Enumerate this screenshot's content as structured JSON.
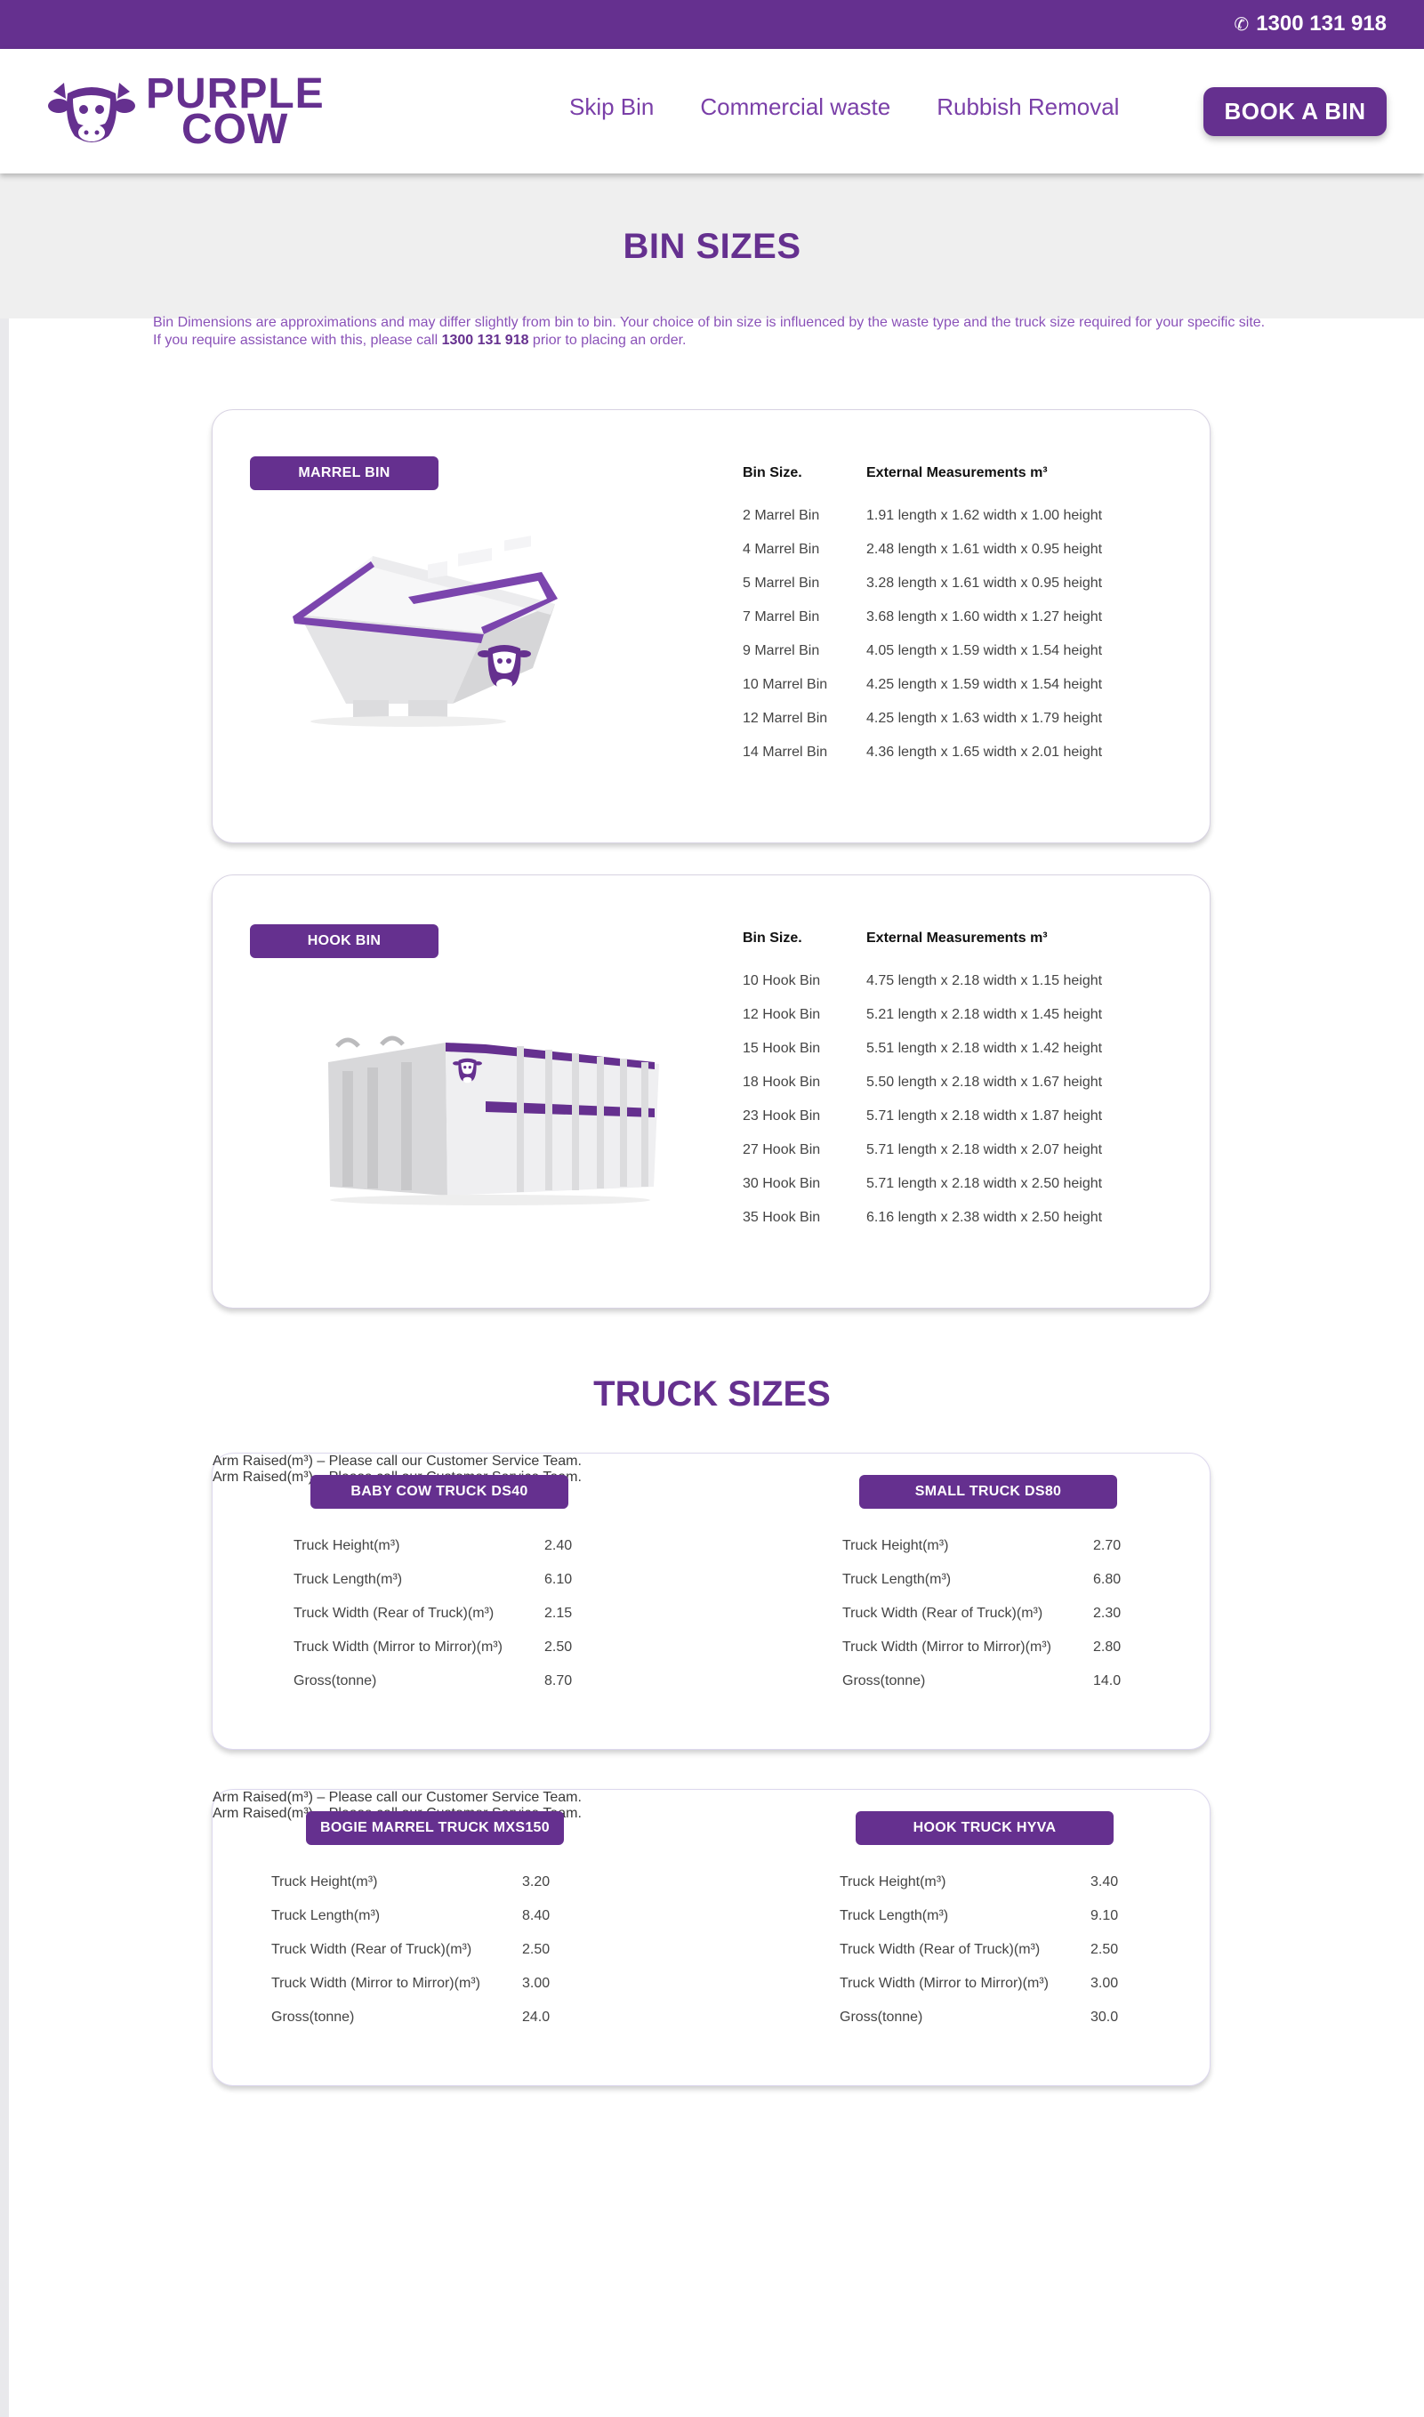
{
  "topbar": {
    "phone": "1300 131 918",
    "phone_icon": "phone-icon"
  },
  "logo": {
    "line1": "PURPLE",
    "line2": "COW",
    "icon": "cow-head-icon"
  },
  "nav": {
    "items": [
      "Skip Bin",
      "Commercial waste",
      "Rubbish Removal"
    ]
  },
  "book_button": "BOOK A BIN",
  "hero": {
    "title": "BIN SIZES"
  },
  "intro": {
    "text1": "Bin Dimensions are approximations and may differ slightly from bin to bin. Your choice of bin size is influenced by the waste type and the truck size required for your specific site. If you require assistance with this, please call ",
    "phone": "1300 131 918",
    "text2": " prior to placing an order."
  },
  "bins": [
    {
      "label": "MARREL BIN",
      "header": [
        "Bin Size.",
        "External Measurements m³"
      ],
      "rows": [
        [
          "2 Marrel Bin",
          "1.91 length x 1.62 width x 1.00 height"
        ],
        [
          "4 Marrel Bin",
          "2.48 length x 1.61 width x 0.95 height"
        ],
        [
          "5 Marrel Bin",
          "3.28 length x 1.61 width x 0.95 height"
        ],
        [
          "7 Marrel Bin",
          "3.68 length x 1.60 width x 1.27 height"
        ],
        [
          "9 Marrel Bin",
          "4.05 length x 1.59 width x 1.54 height"
        ],
        [
          "10 Marrel Bin",
          "4.25 length x 1.59 width x 1.54 height"
        ],
        [
          "12 Marrel Bin",
          "4.25 length x 1.63 width x 1.79 height"
        ],
        [
          "14 Marrel Bin",
          "4.36 length x 1.65 width x 2.01 height"
        ]
      ]
    },
    {
      "label": "HOOK BIN",
      "header": [
        "Bin Size.",
        "External Measurements m³"
      ],
      "rows": [
        [
          "10 Hook Bin",
          "4.75 length x 2.18 width x 1.15 height"
        ],
        [
          "12 Hook Bin",
          "5.21 length x 2.18 width x 1.45 height"
        ],
        [
          "15 Hook Bin",
          "5.51 length x 2.18 width x 1.42 height"
        ],
        [
          "18 Hook Bin",
          "5.50 length x 2.18 width x 1.67 height"
        ],
        [
          "23 Hook Bin",
          "5.71 length x 2.18 width x 1.87 height"
        ],
        [
          "27 Hook Bin",
          "5.71 length x 2.18 width x 2.07 height"
        ],
        [
          "30 Hook Bin",
          "5.71 length x 2.18 width x 2.50 height"
        ],
        [
          "35 Hook Bin",
          "6.16 length x 2.38 width x 2.50 height"
        ]
      ]
    }
  ],
  "truck_title": "TRUCK SIZES",
  "trucks": [
    {
      "label": "BABY COW TRUCK DS40",
      "rows": [
        [
          "Truck Height(m³)",
          "2.40"
        ],
        [
          "Truck Length(m³)",
          "6.10"
        ],
        [
          "Truck Width (Rear of Truck)(m³)",
          "2.15"
        ],
        [
          "Truck Width (Mirror to Mirror)(m³)",
          "2.50"
        ],
        [
          "Gross(tonne)",
          "8.70"
        ]
      ],
      "note": "Arm Raised(m³) – Please call our Customer Service Team."
    },
    {
      "label": "SMALL TRUCK DS80",
      "rows": [
        [
          "Truck Height(m³)",
          "2.70"
        ],
        [
          "Truck Length(m³)",
          "6.80"
        ],
        [
          "Truck Width (Rear of Truck)(m³)",
          "2.30"
        ],
        [
          "Truck Width (Mirror to Mirror)(m³)",
          "2.80"
        ],
        [
          "Gross(tonne)",
          "14.0"
        ]
      ],
      "note": "Arm Raised(m³) – Please call our Customer Service Team."
    },
    {
      "label": "BOGIE MARREL TRUCK MXS150",
      "rows": [
        [
          "Truck Height(m³)",
          "3.20"
        ],
        [
          "Truck Length(m³)",
          "8.40"
        ],
        [
          "Truck Width (Rear of Truck)(m³)",
          "2.50"
        ],
        [
          "Truck Width (Mirror to Mirror)(m³)",
          "3.00"
        ],
        [
          "Gross(tonne)",
          "24.0"
        ]
      ],
      "note": "Arm Raised(m³) – Please call our Customer Service Team."
    },
    {
      "label": "HOOK TRUCK HYVA",
      "rows": [
        [
          "Truck Height(m³)",
          "3.40"
        ],
        [
          "Truck Length(m³)",
          "9.10"
        ],
        [
          "Truck Width (Rear of Truck)(m³)",
          "2.50"
        ],
        [
          "Truck Width (Mirror to Mirror)(m³)",
          "3.00"
        ],
        [
          "Gross(tonne)",
          "30.0"
        ]
      ],
      "note": "Arm Raised(m³) – Please call our Customer Service Team."
    }
  ],
  "colors": {
    "brand": "#65308f",
    "accent_text": "#8a52b8",
    "hero_bg": "#efefef"
  }
}
